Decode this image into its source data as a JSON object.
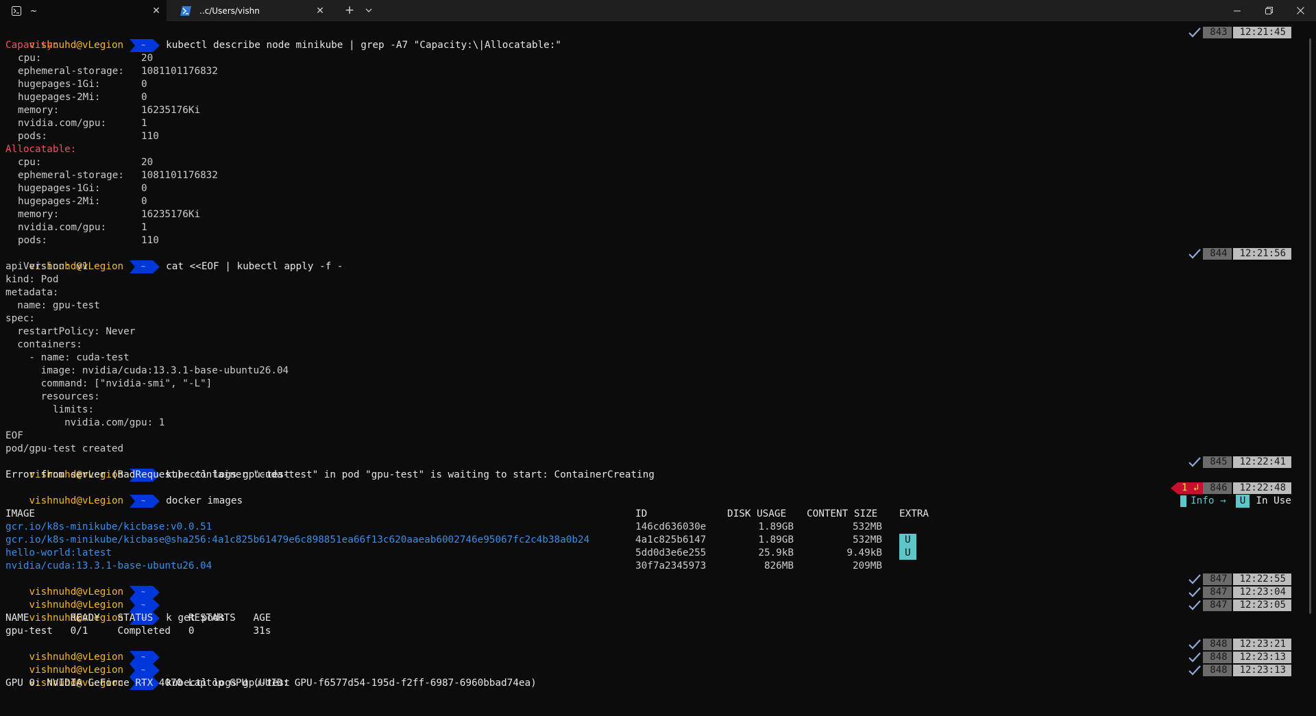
{
  "tabs": [
    {
      "label": "~",
      "close": "✕"
    },
    {
      "label": "..c/Users/vishn",
      "close": "✕"
    }
  ],
  "tabbar": {
    "new_tab": "+"
  },
  "prompt": {
    "user": "vishnuhd@vLegion",
    "dir": "~"
  },
  "cmd1": {
    "command": "kubectl describe node minikube | grep -A7 \"Capacity:\\|Allocatable:\"",
    "status_num": "843",
    "time": "12:21:45",
    "capacity_header": "Capacity:",
    "allocatable_header": "Allocatable:",
    "capacity": [
      {
        "key": "cpu:",
        "value": "20"
      },
      {
        "key": "ephemeral-storage:",
        "value": "1081101176832"
      },
      {
        "key": "hugepages-1Gi:",
        "value": "0"
      },
      {
        "key": "hugepages-2Mi:",
        "value": "0"
      },
      {
        "key": "memory:",
        "value": "16235176Ki"
      },
      {
        "key": "nvidia.com/gpu:",
        "value": "1"
      },
      {
        "key": "pods:",
        "value": "110"
      }
    ],
    "allocatable": [
      {
        "key": "cpu:",
        "value": "20"
      },
      {
        "key": "ephemeral-storage:",
        "value": "1081101176832"
      },
      {
        "key": "hugepages-1Gi:",
        "value": "0"
      },
      {
        "key": "hugepages-2Mi:",
        "value": "0"
      },
      {
        "key": "memory:",
        "value": "16235176Ki"
      },
      {
        "key": "nvidia.com/gpu:",
        "value": "1"
      },
      {
        "key": "pods:",
        "value": "110"
      }
    ]
  },
  "cmd2": {
    "command": "cat <<EOF | kubectl apply -f -",
    "status_num": "844",
    "time": "12:21:56",
    "yaml": [
      "apiVersion: v1",
      "kind: Pod",
      "metadata:",
      "  name: gpu-test",
      "spec:",
      "  restartPolicy: Never",
      "  containers:",
      "    - name: cuda-test",
      "      image: nvidia/cuda:13.3.1-base-ubuntu26.04",
      "      command: [\"nvidia-smi\", \"-L\"]",
      "      resources:",
      "        limits:",
      "          nvidia.com/gpu: 1",
      "EOF"
    ],
    "output": "pod/gpu-test created"
  },
  "cmd3": {
    "command": "kubectl logs gpu-test",
    "status_num": "845",
    "time": "12:22:41",
    "output": "Error from server (BadRequest): container \"cuda-test\" in pod \"gpu-test\" is waiting to start: ContainerCreating"
  },
  "cmd4": {
    "command": "docker images",
    "error_count": "1 ↲",
    "status_num": "846",
    "time": "12:22:48",
    "info_label": "Info →",
    "info_key": "U",
    "info_text": "In Use",
    "headers": {
      "image": "IMAGE",
      "id": "ID",
      "disk": "DISK USAGE",
      "content": "CONTENT SIZE",
      "extra": "EXTRA"
    },
    "rows": [
      {
        "image": "gcr.io/k8s-minikube/kicbase:v0.0.51",
        "id": "146cd636030e",
        "disk": "1.89GB",
        "content": "532MB",
        "extra": ""
      },
      {
        "image": "gcr.io/k8s-minikube/kicbase@sha256:4a1c825b61479e6c898851ea66f13c620aaeab6002746e95067fc2c4b38a0b24",
        "id": "4a1c825b6147",
        "disk": "1.89GB",
        "content": "532MB",
        "extra": "U"
      },
      {
        "image": "hello-world:latest",
        "id": "5dd0d3e6e255",
        "disk": "25.9kB",
        "content": "9.49kB",
        "extra": "U"
      },
      {
        "image": "nvidia/cuda:13.3.1-base-ubuntu26.04",
        "id": "30f7a2345973",
        "disk": "826MB",
        "content": "209MB",
        "extra": ""
      }
    ]
  },
  "empty1": {
    "status_num": "847",
    "time": "12:22:55"
  },
  "empty2": {
    "status_num": "847",
    "time": "12:23:04"
  },
  "cmd5": {
    "command": "k get pods",
    "status_num": "847",
    "time": "12:23:05",
    "header": "NAME       READY   STATUS      RESTARTS   AGE",
    "row": "gpu-test   0/1     Completed   0          31s"
  },
  "empty3": {
    "status_num": "848",
    "time": "12:23:21"
  },
  "empty4": {
    "status_num": "848",
    "time": "12:23:13"
  },
  "cmd6": {
    "command": "kubectl logs gpu-test",
    "status_num": "848",
    "time": "12:23:13",
    "output": "GPU 0: NVIDIA GeForce RTX 4070 Laptop GPU (UUID: GPU-f6577d54-195d-f2ff-6987-6960bbad74ea)"
  },
  "colors": {
    "prompt_user": "#f5b829",
    "prompt_bg": "#0037da",
    "header_red": "#f74f63",
    "link_blue": "#3b8eea",
    "badge": "#5cc6c9",
    "error_bg": "#c8102e"
  }
}
